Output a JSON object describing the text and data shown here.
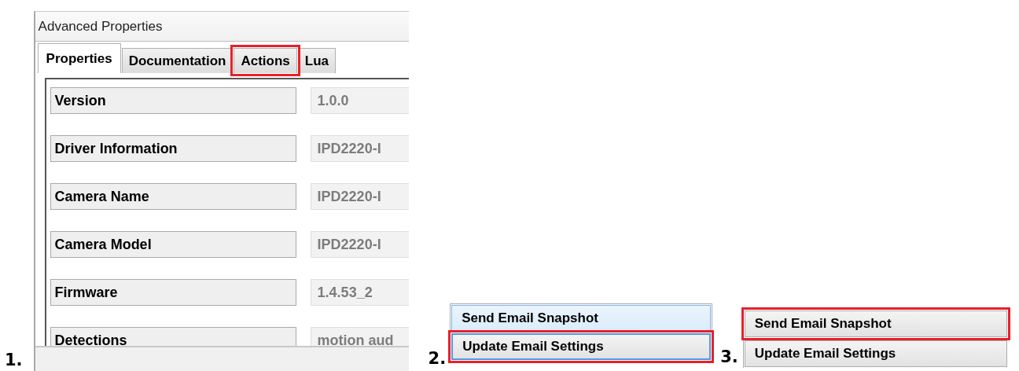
{
  "panels": [
    {
      "number": "1.",
      "kind": "properties",
      "window_title": "Advanced Properties",
      "tabs": [
        {
          "label": "Properties",
          "selected": true,
          "highlighted": false
        },
        {
          "label": "Documentation",
          "selected": false,
          "highlighted": false
        },
        {
          "label": "Actions",
          "selected": false,
          "highlighted": true
        },
        {
          "label": "Lua",
          "selected": false,
          "highlighted": false
        }
      ],
      "fields": [
        {
          "label": "Version",
          "value": "1.0.0"
        },
        {
          "label": "Driver Information",
          "value": "IPD2220-I"
        },
        {
          "label": "Camera Name",
          "value": "IPD2220-I"
        },
        {
          "label": "Camera Model",
          "value": "IPD2220-I"
        },
        {
          "label": "Firmware",
          "value": "1.4.53_2"
        },
        {
          "label": "Detections",
          "value": "motion aud"
        }
      ]
    },
    {
      "number": "2.",
      "kind": "actions",
      "buttons": [
        {
          "label": "Send Email Snapshot",
          "hovered": true,
          "focused": false,
          "highlighted": false
        },
        {
          "label": "Update Email Settings",
          "hovered": false,
          "focused": true,
          "highlighted": true
        }
      ]
    },
    {
      "number": "3.",
      "kind": "actions",
      "buttons": [
        {
          "label": "Send Email Snapshot",
          "hovered": false,
          "focused": false,
          "highlighted": true
        },
        {
          "label": "Update Email Settings",
          "hovered": false,
          "focused": false,
          "highlighted": false
        }
      ]
    }
  ]
}
